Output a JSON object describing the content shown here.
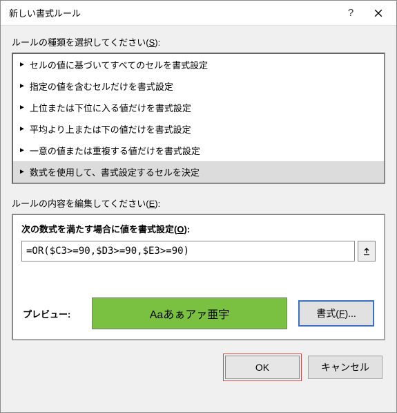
{
  "title": "新しい書式ルール",
  "section_label_pre": "ルールの種類を選択してください(",
  "section_label_key": "S",
  "section_label_post": "):",
  "rule_types": [
    "セルの値に基づいてすべてのセルを書式設定",
    "指定の値を含むセルだけを書式設定",
    "上位または下位に入る値だけを書式設定",
    "平均より上または下の値だけを書式設定",
    "一意の値または重複する値だけを書式設定",
    "数式を使用して、書式設定するセルを決定"
  ],
  "edit_label_pre": "ルールの内容を編集してください(",
  "edit_label_key": "E",
  "edit_label_post": "):",
  "formula_label_pre": "次の数式を満たす場合に値を書式設定(",
  "formula_label_key": "O",
  "formula_label_post": "):",
  "formula_value": "=OR($C3>=90,$D3>=90,$E3>=90)",
  "preview_label": "プレビュー:",
  "preview_sample": "Aaあぁアァ亜宇",
  "format_button_pre": "書式(",
  "format_button_key": "F",
  "format_button_post": ")...",
  "ok_label": "OK",
  "cancel_label": "キャンセル"
}
